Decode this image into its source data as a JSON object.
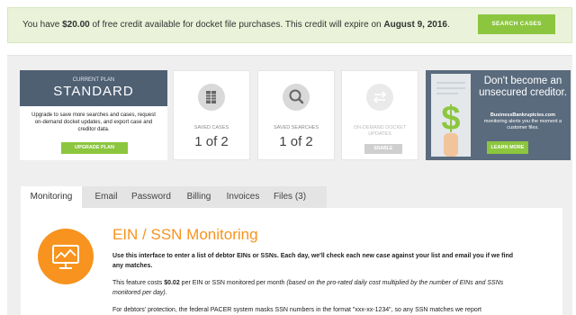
{
  "banner": {
    "text_pre": "You have ",
    "amount": "$20.00",
    "text_mid": " of free credit available for docket file purchases. This credit will expire on ",
    "date": "August 9, 2016",
    "text_post": ".",
    "search_button": "SEARCH CASES"
  },
  "plan": {
    "caption": "CURRENT PLAN",
    "name": "STANDARD",
    "description": "Upgrade to save more searches and cases, request on-demand docket updates, and export case and creditor data.",
    "upgrade_button": "UPGRADE PLAN"
  },
  "saved_cases": {
    "label": "SAVED CASES",
    "value": "1 of 2"
  },
  "saved_searches": {
    "label": "SAVED SEARCHES",
    "value": "1 of 2"
  },
  "docket_updates": {
    "label": "ON-DEMAND DOCKET UPDATES",
    "button": "ENABLE"
  },
  "ad": {
    "headline": "Don't become an unsecured creditor.",
    "site": "BusinessBankruptcies.com",
    "body": "monitoring alerts you the moment a customer files.",
    "button": "LEARN MORE"
  },
  "tabs": [
    {
      "label": "Monitoring"
    },
    {
      "label": "Email"
    },
    {
      "label": "Password"
    },
    {
      "label": "Billing"
    },
    {
      "label": "Invoices"
    },
    {
      "label": "Files (3)"
    }
  ],
  "monitoring": {
    "title": "EIN / SSN Monitoring",
    "intro": "Use this interface to enter a list of debtor EINs or SSNs. Each day, we'll check each new case against your list and email you if we find any matches.",
    "cost_pre": "This feature costs ",
    "cost_amount": "$0.02",
    "cost_mid": " per EIN or SSN monitored per month ",
    "cost_note": "(based on the pro-rated daily cost multiplied by the number of EINs and SSNs monitored per day).",
    "protection": "For debtors' protection, the federal PACER system masks SSN numbers in the format \"xxx-xx-1234\", so any SSN matches we report"
  },
  "colors": {
    "accent_green": "#8cc63f",
    "accent_orange": "#f7931e",
    "plan_header": "#4f6073"
  }
}
